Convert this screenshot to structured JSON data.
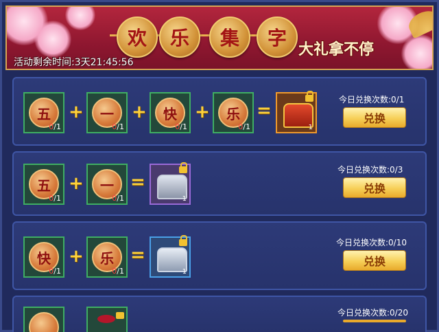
{
  "banner": {
    "title_chars": [
      "欢",
      "乐",
      "集",
      "字"
    ],
    "slogan": "大礼拿不停",
    "timer": "活动剩余时间:3天21:45:56"
  },
  "rows": [
    {
      "pieces": [
        {
          "char": "五",
          "owned": "0",
          "need": "/1"
        },
        {
          "char": "一",
          "owned": "0",
          "need": "/1"
        },
        {
          "char": "快",
          "owned": "0",
          "need": "/1"
        },
        {
          "char": "乐",
          "owned": "0",
          "need": "/1"
        }
      ],
      "reward": {
        "type": "gold-chest",
        "qty": "1"
      },
      "limit": "今日兑换次数:0/1",
      "button": "兑换"
    },
    {
      "pieces": [
        {
          "char": "五",
          "owned": "0",
          "need": "/1"
        },
        {
          "char": "一",
          "owned": "0",
          "need": "/1"
        }
      ],
      "reward": {
        "type": "purple-chest",
        "qty": "1"
      },
      "limit": "今日兑换次数:0/3",
      "button": "兑换"
    },
    {
      "pieces": [
        {
          "char": "快",
          "owned": "0",
          "need": "/1"
        },
        {
          "char": "乐",
          "owned": "0",
          "need": "/1"
        }
      ],
      "reward": {
        "type": "blue-chest",
        "qty": "1"
      },
      "limit": "今日兑换次数:0/10",
      "button": "兑换"
    },
    {
      "limit": "今日兑换次数:0/20"
    }
  ],
  "ops": {
    "plus": "+",
    "equals": "="
  },
  "colors": {
    "gold": "#ffd23a",
    "accent_red": "#b3263d",
    "panel": "#2d3a78"
  }
}
